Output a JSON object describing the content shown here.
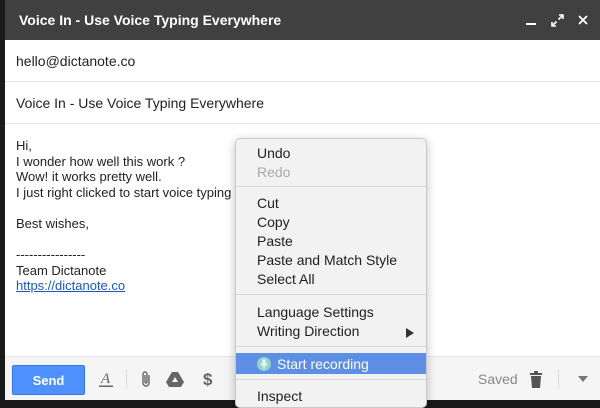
{
  "window": {
    "title": "Voice In - Use Voice Typing Everywhere",
    "minimize_icon": "minimize-icon",
    "expand_icon": "expand-icon",
    "close_icon": "close-icon"
  },
  "fields": {
    "to": "hello@dictanote.co",
    "subject": "Voice In - Use Voice Typing Everywhere"
  },
  "body": {
    "lines": [
      "Hi,",
      "I wonder how well this work ?",
      "Wow! it works pretty well.",
      "I just right clicked to start voice typing",
      "",
      "Best wishes,",
      "",
      "----------------",
      "Team Dictanote"
    ],
    "link": "https://dictanote.co"
  },
  "toolbar": {
    "send_label": "Send",
    "saved_label": "Saved",
    "icons": [
      "text-format-icon",
      "paperclip-icon",
      "google-drive-icon",
      "dollar-icon",
      "trash-icon",
      "dropdown-arrow-icon"
    ]
  },
  "context_menu": {
    "items": [
      {
        "label": "Undo",
        "disabled": false
      },
      {
        "label": "Redo",
        "disabled": true
      },
      {
        "label": "Cut",
        "disabled": false
      },
      {
        "label": "Copy",
        "disabled": false
      },
      {
        "label": "Paste",
        "disabled": false
      },
      {
        "label": "Paste and Match Style",
        "disabled": false
      },
      {
        "label": "Select All",
        "disabled": false
      },
      {
        "label": "Language Settings",
        "disabled": false
      },
      {
        "label": "Writing Direction",
        "disabled": false,
        "submenu": true
      },
      {
        "label": "Start recording",
        "disabled": false,
        "highlighted": true
      },
      {
        "label": "Inspect",
        "disabled": false
      }
    ]
  },
  "colors": {
    "titlebar": "#404040",
    "send_button": "#4d90fe",
    "menu_highlight": "#5d8fe6",
    "link": "#1a55c9"
  }
}
